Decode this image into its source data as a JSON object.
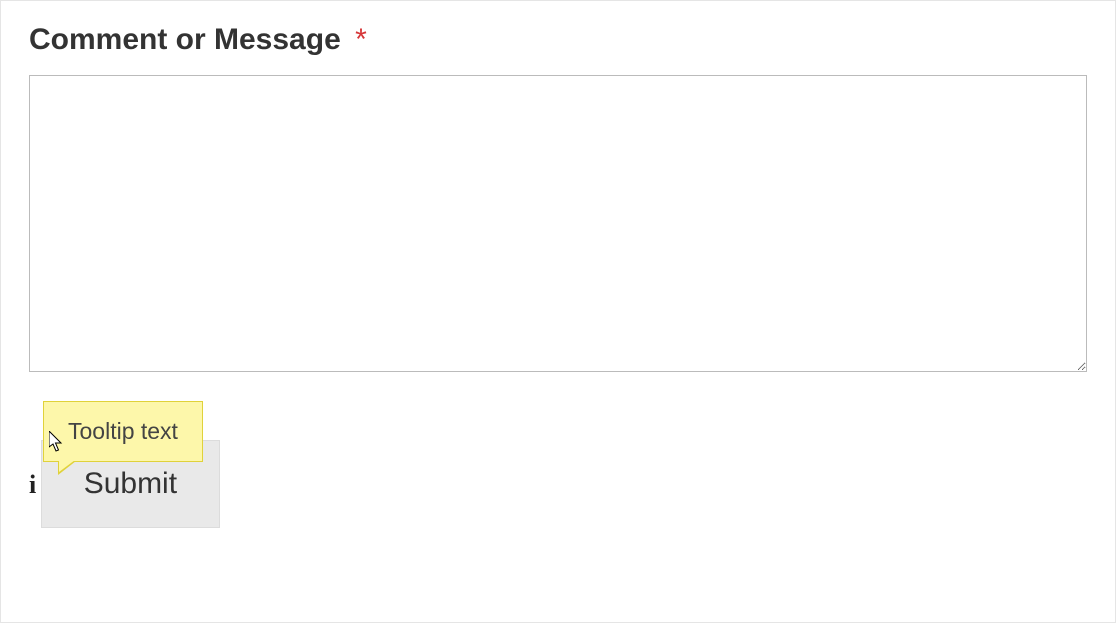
{
  "form": {
    "field_label": "Comment or Message",
    "required_marker": "*",
    "textarea_value": "",
    "tooltip_text": "Tooltip text",
    "info_icon_glyph": "i",
    "submit_label": "Submit"
  }
}
